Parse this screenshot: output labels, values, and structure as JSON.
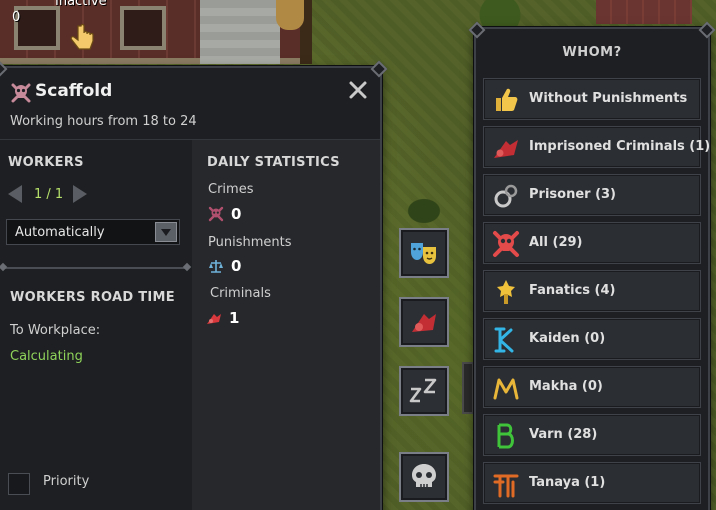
{
  "hud": {
    "count": "0",
    "status": "Inactive"
  },
  "building": {
    "title": "Scaffold",
    "subtitle": "Working hours from 18 to 24"
  },
  "workers": {
    "heading": "WORKERS",
    "count": "1 / 1",
    "mode": "Automatically"
  },
  "road_time": {
    "heading": "WORKERS ROAD TIME",
    "to_workplace_label": "To Workplace:",
    "to_workplace_value": "Calculating"
  },
  "priority": {
    "label": "Priority",
    "checked": false
  },
  "daily_statistics": {
    "heading": "DAILY STATISTICS",
    "stats": [
      {
        "label": "Crimes",
        "value": "0",
        "icon": "skull-crossbones-icon"
      },
      {
        "label": "Punishments",
        "value": "0",
        "icon": "scales-icon"
      },
      {
        "label": "Criminals",
        "value": "1",
        "icon": "criminal-icon"
      }
    ]
  },
  "side_actions": [
    {
      "name": "masks-icon"
    },
    {
      "name": "criminal-icon"
    },
    {
      "name": "sleep-icon"
    },
    {
      "name": "skull-icon"
    }
  ],
  "whom": {
    "title": "WHOM?",
    "options": [
      {
        "label": "Without Punishments",
        "icon": "thumbs-up-icon"
      },
      {
        "label": "Imprisoned Criminals (1)",
        "icon": "criminal-icon"
      },
      {
        "label": "Prisoner (3)",
        "icon": "shackles-icon"
      },
      {
        "label": "All (29)",
        "icon": "skull-crossbones-icon"
      },
      {
        "label": "Fanatics (4)",
        "icon": "fanatic-icon"
      },
      {
        "label": "Kaiden (0)",
        "icon": "kaiden-glyph-icon"
      },
      {
        "label": "Makha (0)",
        "icon": "makha-glyph-icon"
      },
      {
        "label": "Varn (28)",
        "icon": "varn-glyph-icon"
      },
      {
        "label": "Tanaya (1)",
        "icon": "tanaya-glyph-icon"
      }
    ]
  },
  "colors": {
    "accent_green": "#8fd35a",
    "stepper_green": "#b6e06a",
    "panel_bg": "#1d1f22",
    "skull_red": "#e34a4a"
  }
}
